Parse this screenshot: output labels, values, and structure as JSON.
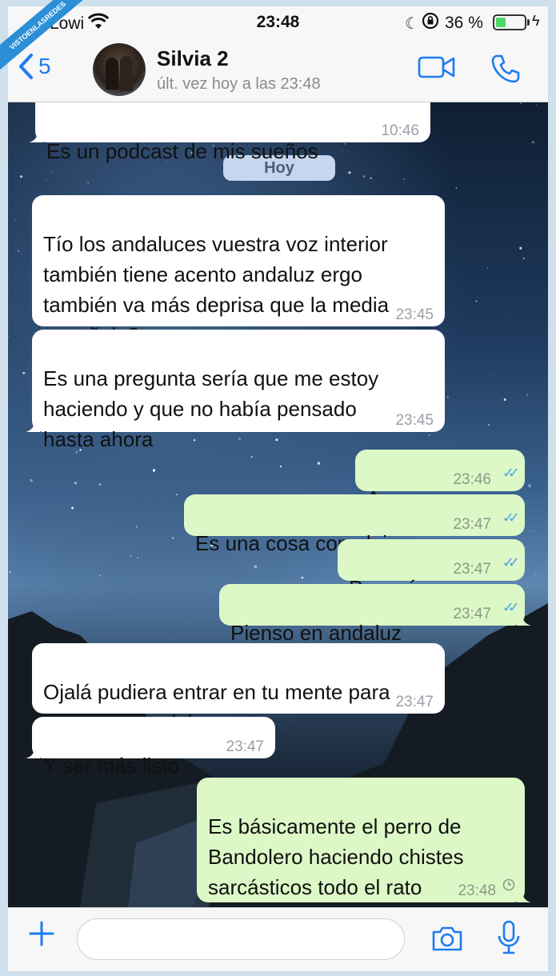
{
  "status_bar": {
    "carrier": "Lowi",
    "time": "23:48",
    "battery": "36 %",
    "battery_level": 0.36
  },
  "header": {
    "back_count": "5",
    "contact_name": "Silvia 2",
    "last_seen": "últ. vez hoy a las 23:48"
  },
  "watermark": "VISTOENLASREDES",
  "chat": {
    "date_separator": "Hoy",
    "messages": [
      {
        "dir": "in",
        "text": "Es un podcast de mis sueños",
        "time": "10:46"
      },
      {
        "dir": "in",
        "text": "Tío los andaluces vuestra voz interior\ntambién tiene acento andaluz ergo\ntambién va más deprisa que la media\nesoañola?",
        "time": "23:45"
      },
      {
        "dir": "in",
        "text": "Es una pregunta sería que me estoy\nhaciendo y que no había pensado\nhasta ahora",
        "time": "23:45"
      },
      {
        "dir": "out",
        "text": "A ver",
        "time": "23:46",
        "status": "read"
      },
      {
        "dir": "out",
        "text": "Es una cosa compleja",
        "time": "23:47",
        "status": "read"
      },
      {
        "dir": "out",
        "text": "Pero sí",
        "time": "23:47",
        "status": "read"
      },
      {
        "dir": "out",
        "text": "Pienso en andaluz",
        "time": "23:47",
        "status": "read"
      },
      {
        "dir": "in",
        "text": "Ojalá pudiera entrar en tu mente para\npensar en andaluz",
        "time": "23:47"
      },
      {
        "dir": "in",
        "text": "Y ser más listo",
        "time": "23:47"
      },
      {
        "dir": "out",
        "text": "Es básicamente el perro de\nBandolero haciendo chistes\nsarcásticos todo el rato",
        "time": "23:48",
        "status": "pending"
      }
    ]
  },
  "input": {
    "placeholder": ""
  },
  "colors": {
    "accent": "#1e7cf0",
    "incoming_bubble": "#ffffff",
    "outgoing_bubble": "#dcf8c6",
    "read_ticks": "#4fa4e8",
    "battery_green": "#4cd964"
  }
}
